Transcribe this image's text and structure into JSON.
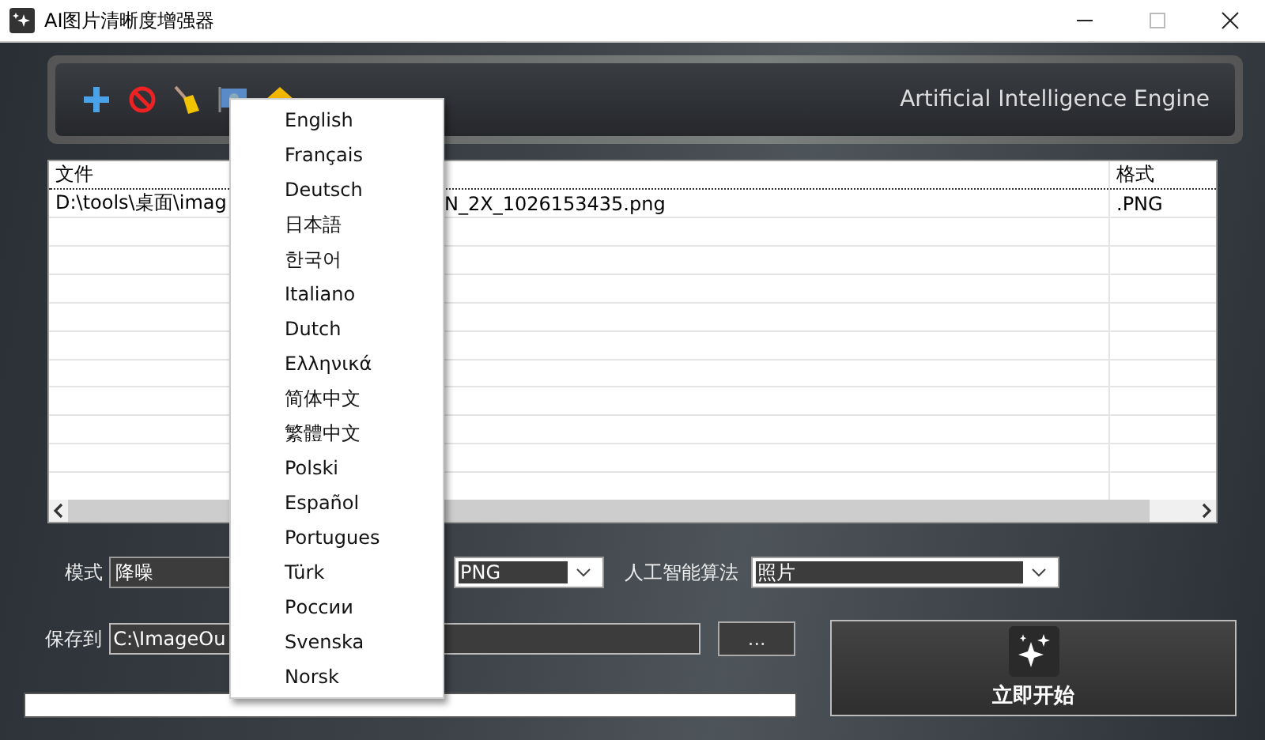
{
  "window": {
    "title": "AI图片清晰度增强器"
  },
  "toolbar": {
    "engine_label": "Artificial Intelligence Engine"
  },
  "table": {
    "columns": [
      "文件",
      "格式"
    ],
    "rows": [
      {
        "file_start": "D:\\tools\\桌面\\imag",
        "file_end": "N_2X_1026153435.png",
        "format": ".PNG"
      }
    ]
  },
  "settings": {
    "mode_label": "模式",
    "mode_value": "降噪",
    "format_value": "PNG",
    "algorithm_label": "人工智能算法",
    "algorithm_value": "照片",
    "save_label": "保存到",
    "save_value": "C:\\ImageOu",
    "browse_button": "...",
    "start_button": "立即开始",
    "progress": {
      "level": 0
    }
  },
  "language_menu": {
    "items": [
      {
        "label": "English"
      },
      {
        "label": "Français"
      },
      {
        "label": "Deutsch"
      },
      {
        "label": "日本語"
      },
      {
        "label": "한국어"
      },
      {
        "label": "Italiano"
      },
      {
        "label": "Dutch"
      },
      {
        "label": "Ελληνικά"
      },
      {
        "label": "简体中文"
      },
      {
        "label": "繁體中文"
      },
      {
        "label": "Polski"
      },
      {
        "label": "Español"
      },
      {
        "label": "Portugues"
      },
      {
        "label": "Türk"
      },
      {
        "label": "России"
      },
      {
        "label": "Svenska"
      },
      {
        "label": "Norsk"
      }
    ]
  }
}
